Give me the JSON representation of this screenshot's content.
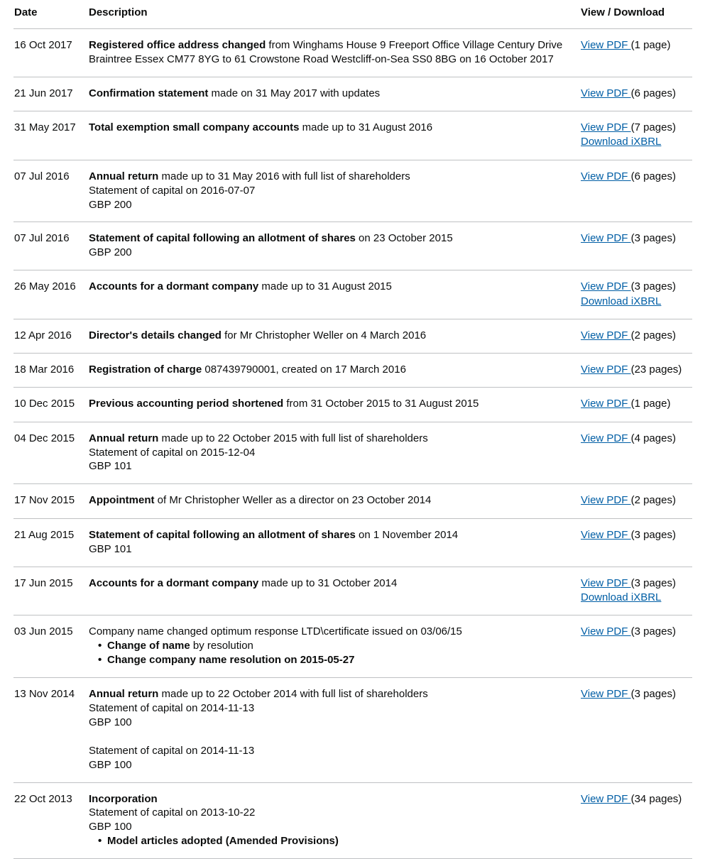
{
  "table": {
    "headers": {
      "date": "Date",
      "description": "Description",
      "view_download": "View / Download"
    },
    "link_color": "#005ea5",
    "border_color": "#bfc1c3",
    "text_color": "#0b0c0c",
    "rows": [
      {
        "date": "16 Oct 2017",
        "lead": "Registered office address changed",
        "rest": " from Winghams House 9 Freeport Office Village Century Drive Braintree Essex CM77 8YG to 61 Crowstone Road Westcliff-on-Sea SS0 8BG on 16 October 2017",
        "extra_lines": [],
        "bullets": [],
        "view_label": "View PDF ",
        "pages": "(1 page)",
        "ixbrl_label": ""
      },
      {
        "date": "21 Jun 2017",
        "lead": "Confirmation statement",
        "rest": " made on 31 May 2017 with updates",
        "extra_lines": [],
        "bullets": [],
        "view_label": "View PDF ",
        "pages": "(6 pages)",
        "ixbrl_label": ""
      },
      {
        "date": "31 May 2017",
        "lead": "Total exemption small company accounts",
        "rest": " made up to 31 August 2016",
        "extra_lines": [],
        "bullets": [],
        "view_label": "View PDF ",
        "pages": "(7 pages)",
        "ixbrl_label": "Download iXBRL"
      },
      {
        "date": "07 Jul 2016",
        "lead": "Annual return",
        "rest": " made up to 31 May 2016 with full list of shareholders",
        "extra_lines": [
          "Statement of capital on 2016-07-07",
          "GBP 200"
        ],
        "bullets": [],
        "view_label": "View PDF ",
        "pages": "(6 pages)",
        "ixbrl_label": ""
      },
      {
        "date": "07 Jul 2016",
        "lead": "Statement of capital following an allotment of shares",
        "rest": " on 23 October 2015",
        "extra_lines": [
          "GBP 200"
        ],
        "bullets": [],
        "view_label": "View PDF ",
        "pages": "(3 pages)",
        "ixbrl_label": ""
      },
      {
        "date": "26 May 2016",
        "lead": "Accounts for a dormant company",
        "rest": " made up to 31 August 2015",
        "extra_lines": [],
        "bullets": [],
        "view_label": "View PDF ",
        "pages": "(3 pages)",
        "ixbrl_label": "Download iXBRL"
      },
      {
        "date": "12 Apr 2016",
        "lead": "Director's details changed",
        "rest": " for Mr Christopher Weller on 4 March 2016",
        "extra_lines": [],
        "bullets": [],
        "view_label": "View PDF ",
        "pages": "(2 pages)",
        "ixbrl_label": ""
      },
      {
        "date": "18 Mar 2016",
        "lead": "Registration of charge",
        "rest": " 087439790001, created on 17 March 2016",
        "extra_lines": [],
        "bullets": [],
        "view_label": "View PDF ",
        "pages": "(23 pages)",
        "ixbrl_label": ""
      },
      {
        "date": "10 Dec 2015",
        "lead": "Previous accounting period shortened",
        "rest": " from 31 October 2015 to 31 August 2015",
        "extra_lines": [],
        "bullets": [],
        "view_label": "View PDF ",
        "pages": "(1 page)",
        "ixbrl_label": ""
      },
      {
        "date": "04 Dec 2015",
        "lead": "Annual return",
        "rest": " made up to 22 October 2015 with full list of shareholders",
        "extra_lines": [
          "Statement of capital on 2015-12-04",
          "GBP 101"
        ],
        "bullets": [],
        "view_label": "View PDF ",
        "pages": "(4 pages)",
        "ixbrl_label": ""
      },
      {
        "date": "17 Nov 2015",
        "lead": "Appointment",
        "rest": " of Mr Christopher Weller as a director on 23 October 2014",
        "extra_lines": [],
        "bullets": [],
        "view_label": "View PDF ",
        "pages": "(2 pages)",
        "ixbrl_label": ""
      },
      {
        "date": "21 Aug 2015",
        "lead": "Statement of capital following an allotment of shares",
        "rest": " on 1 November 2014",
        "extra_lines": [
          "GBP 101"
        ],
        "bullets": [],
        "view_label": "View PDF ",
        "pages": "(3 pages)",
        "ixbrl_label": ""
      },
      {
        "date": "17 Jun 2015",
        "lead": "Accounts for a dormant company",
        "rest": " made up to 31 October 2014",
        "extra_lines": [],
        "bullets": [],
        "view_label": "View PDF ",
        "pages": "(3 pages)",
        "ixbrl_label": "Download iXBRL"
      },
      {
        "date": "03 Jun 2015",
        "lead": "",
        "rest": "Company name changed optimum response LTD\\certificate issued on 03/06/15",
        "extra_lines": [],
        "bullets": [
          {
            "bold": "Change of name",
            "normal": " by resolution"
          },
          {
            "bold": "Change company name resolution on 2015-05-27",
            "normal": ""
          }
        ],
        "view_label": "View PDF ",
        "pages": "(3 pages)",
        "ixbrl_label": ""
      },
      {
        "date": "13 Nov 2014",
        "lead": "Annual return",
        "rest": " made up to 22 October 2014 with full list of shareholders",
        "extra_lines": [
          "Statement of capital on 2014-11-13",
          "GBP 100",
          "",
          "Statement of capital on 2014-11-13",
          "GBP 100"
        ],
        "bullets": [],
        "view_label": "View PDF ",
        "pages": "(3 pages)",
        "ixbrl_label": ""
      },
      {
        "date": "22 Oct 2013",
        "lead": "Incorporation",
        "rest": "",
        "extra_lines": [
          "Statement of capital on 2013-10-22",
          "GBP 100"
        ],
        "bullets": [
          {
            "bold": "Model articles adopted (Amended Provisions)",
            "normal": ""
          }
        ],
        "view_label": "View PDF ",
        "pages": "(34 pages)",
        "ixbrl_label": ""
      }
    ]
  }
}
